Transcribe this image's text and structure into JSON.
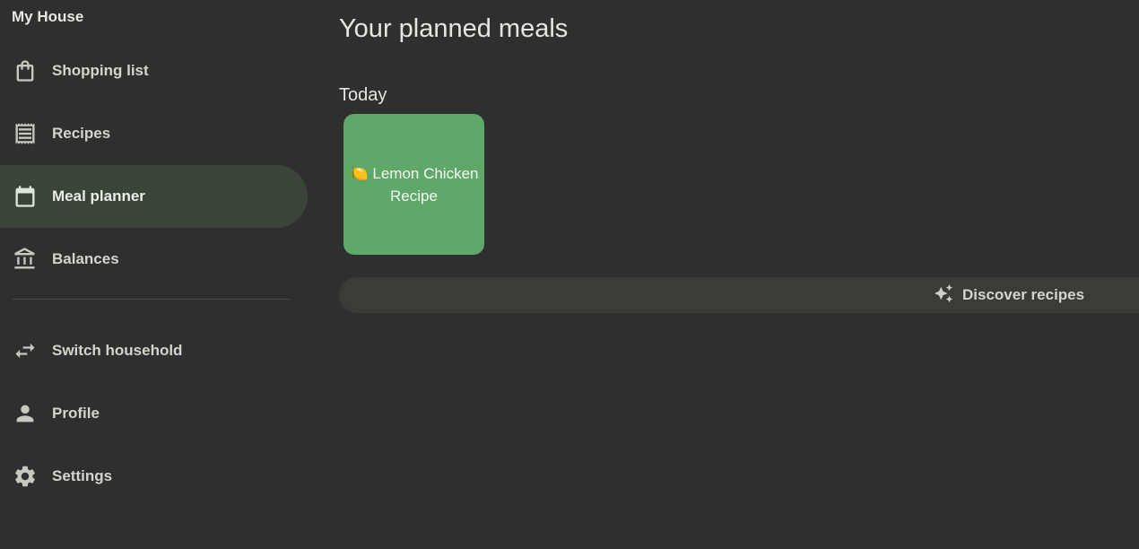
{
  "sidebar": {
    "household_name": "My House",
    "items": [
      {
        "label": "Shopping list",
        "icon": "shopping-bag-icon",
        "active": false
      },
      {
        "label": "Recipes",
        "icon": "receipt-icon",
        "active": false
      },
      {
        "label": "Meal planner",
        "icon": "calendar-icon",
        "active": true
      },
      {
        "label": "Balances",
        "icon": "bank-icon",
        "active": false
      }
    ],
    "secondary_items": [
      {
        "label": "Switch household",
        "icon": "swap-arrows-icon"
      },
      {
        "label": "Profile",
        "icon": "person-icon"
      },
      {
        "label": "Settings",
        "icon": "gear-icon"
      }
    ]
  },
  "main": {
    "title": "Your planned meals",
    "sections": [
      {
        "heading": "Today",
        "meals": [
          {
            "label": "🍋 Lemon Chicken Recipe"
          }
        ]
      }
    ],
    "discover": {
      "label": "Discover recipes",
      "icon": "sparkle-icon"
    }
  },
  "colors": {
    "background": "#2f2f2f",
    "active_nav": "#3a4439",
    "meal_card": "#5fa86a",
    "discover_bar": "#393c37"
  }
}
